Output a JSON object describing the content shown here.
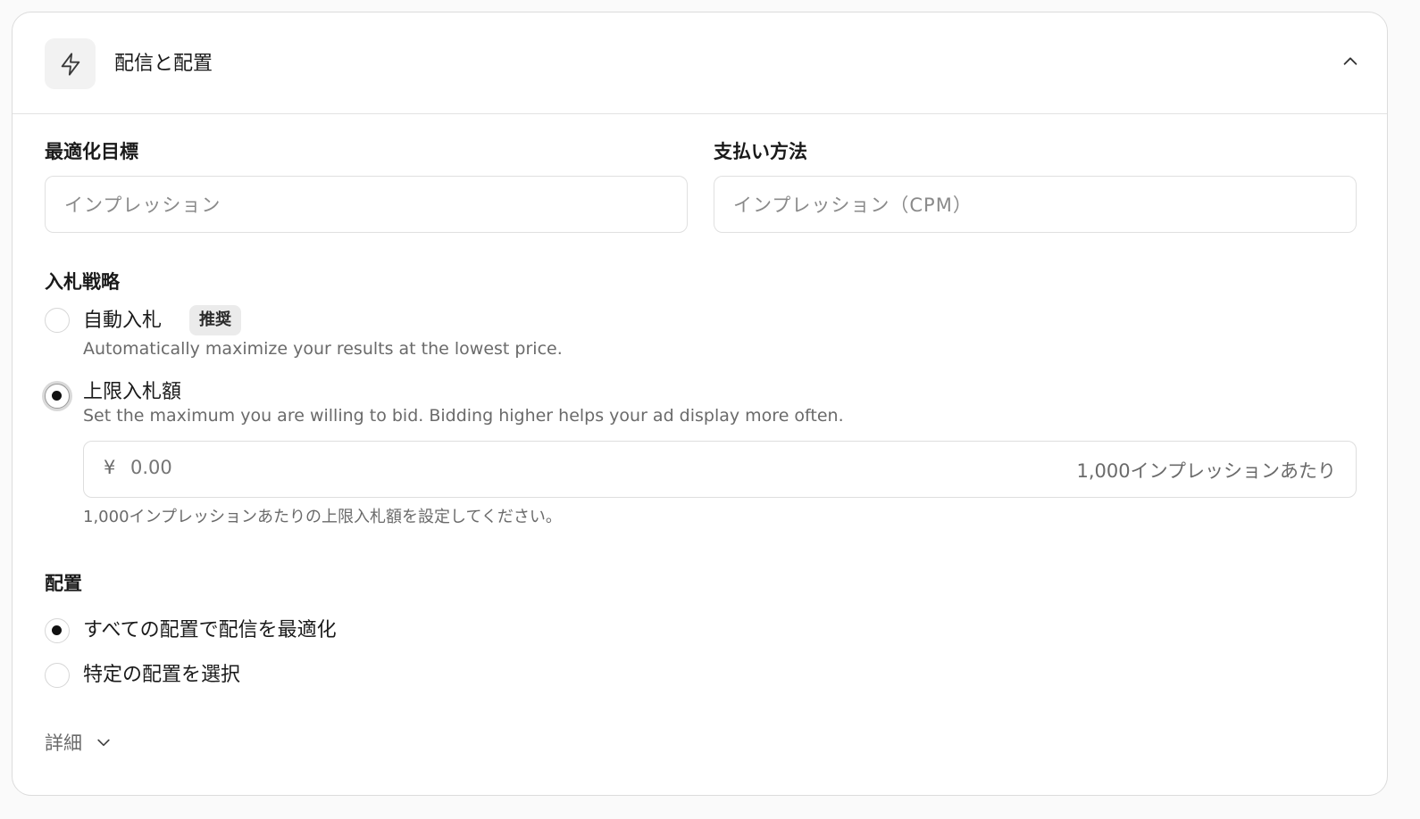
{
  "header": {
    "title": "配信と配置",
    "icon": "lightning-icon",
    "collapse_icon": "chevron-up-icon"
  },
  "optimization_goal": {
    "label": "最適化目標",
    "placeholder": "インプレッション"
  },
  "payment_method": {
    "label": "支払い方法",
    "placeholder": "インプレッション（CPM）"
  },
  "bid_strategy": {
    "label": "入札戦略",
    "options": [
      {
        "label": "自動入札",
        "badge": "推奨",
        "description": "Automatically maximize your results at the lowest price.",
        "selected": false
      },
      {
        "label": "上限入札額",
        "description": "Set the maximum you are willing to bid. Bidding higher helps your ad display more often.",
        "selected": true
      }
    ],
    "bid_input": {
      "currency": "¥",
      "placeholder": "0.00",
      "suffix": "1,000インプレッションあたり",
      "hint": "1,000インプレッションあたりの上限入札額を設定してください。"
    }
  },
  "placement": {
    "label": "配置",
    "options": [
      {
        "label": "すべての配置で配信を最適化",
        "selected": true
      },
      {
        "label": "特定の配置を選択",
        "selected": false
      }
    ]
  },
  "details": {
    "label": "詳細",
    "icon": "chevron-down-icon"
  }
}
